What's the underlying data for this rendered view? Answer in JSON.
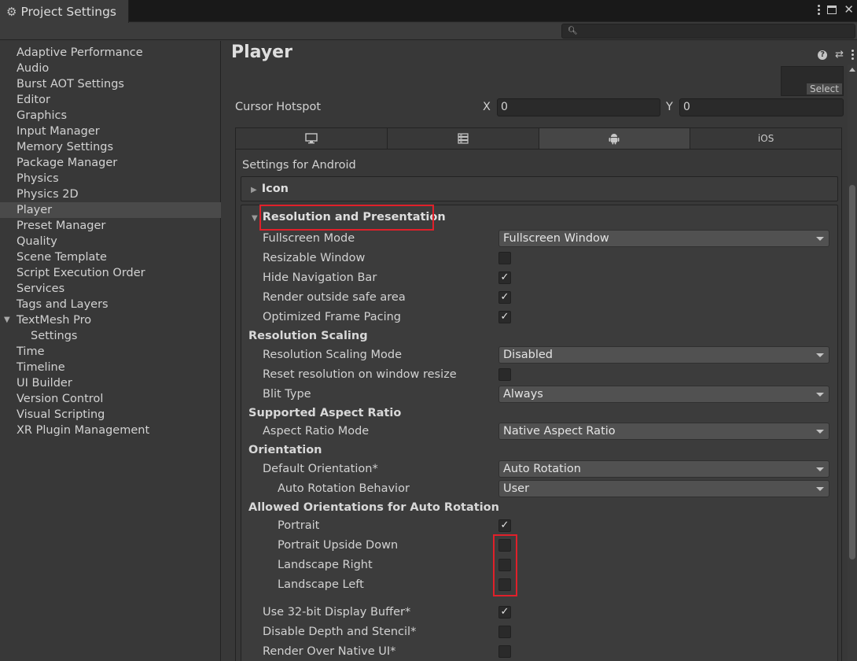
{
  "window": {
    "title": "Project Settings",
    "title_icon": "gear-icon"
  },
  "sidebar": {
    "items": [
      {
        "label": "Adaptive Performance"
      },
      {
        "label": "Audio"
      },
      {
        "label": "Burst AOT Settings"
      },
      {
        "label": "Editor"
      },
      {
        "label": "Graphics"
      },
      {
        "label": "Input Manager"
      },
      {
        "label": "Memory Settings"
      },
      {
        "label": "Package Manager"
      },
      {
        "label": "Physics"
      },
      {
        "label": "Physics 2D"
      },
      {
        "label": "Player",
        "selected": true
      },
      {
        "label": "Preset Manager"
      },
      {
        "label": "Quality"
      },
      {
        "label": "Scene Template"
      },
      {
        "label": "Script Execution Order"
      },
      {
        "label": "Services"
      },
      {
        "label": "Tags and Layers"
      },
      {
        "label": "TextMesh Pro",
        "expanded": true
      },
      {
        "label": "Settings",
        "child": true
      },
      {
        "label": "Time"
      },
      {
        "label": "Timeline"
      },
      {
        "label": "UI Builder"
      },
      {
        "label": "Version Control"
      },
      {
        "label": "Visual Scripting"
      },
      {
        "label": "XR Plugin Management"
      }
    ]
  },
  "main": {
    "title": "Player",
    "select_button": "Select",
    "cursor_hotspot": {
      "label": "Cursor Hotspot",
      "x_label": "X",
      "x_value": "0",
      "y_label": "Y",
      "y_value": "0"
    },
    "platform_tabs": [
      {
        "icon": "monitor-icon",
        "active": false
      },
      {
        "icon": "server-icon",
        "active": false
      },
      {
        "icon": "android-icon",
        "active": true
      },
      {
        "label": "iOS",
        "active": false
      }
    ],
    "settings_for": "Settings for Android",
    "icon_section": "Icon",
    "resolution_section": "Resolution and Presentation",
    "fullscreen_mode": {
      "label": "Fullscreen Mode",
      "value": "Fullscreen Window"
    },
    "resizable_window": {
      "label": "Resizable Window",
      "checked": false
    },
    "hide_nav_bar": {
      "label": "Hide Navigation Bar",
      "checked": true
    },
    "render_outside_safe": {
      "label": "Render outside safe area",
      "checked": true
    },
    "optimized_frame_pacing": {
      "label": "Optimized Frame Pacing",
      "checked": true
    },
    "resolution_scaling_header": "Resolution Scaling",
    "resolution_scaling_mode": {
      "label": "Resolution Scaling Mode",
      "value": "Disabled"
    },
    "reset_resolution": {
      "label": "Reset resolution on window resize",
      "checked": false
    },
    "blit_type": {
      "label": "Blit Type",
      "value": "Always"
    },
    "aspect_header": "Supported Aspect Ratio",
    "aspect_ratio_mode": {
      "label": "Aspect Ratio Mode",
      "value": "Native Aspect Ratio"
    },
    "orientation_header": "Orientation",
    "default_orientation": {
      "label": "Default Orientation*",
      "value": "Auto Rotation"
    },
    "auto_rotation_behavior": {
      "label": "Auto Rotation Behavior",
      "value": "User"
    },
    "allowed_orientations_header": "Allowed Orientations for Auto Rotation",
    "portrait": {
      "label": "Portrait",
      "checked": true
    },
    "portrait_upside_down": {
      "label": "Portrait Upside Down",
      "checked": false
    },
    "landscape_right": {
      "label": "Landscape Right",
      "checked": false
    },
    "landscape_left": {
      "label": "Landscape Left",
      "checked": false
    },
    "use_32bit_buffer": {
      "label": "Use 32-bit Display Buffer*",
      "checked": true
    },
    "disable_depth_stencil": {
      "label": "Disable Depth and Stencil*",
      "checked": false
    },
    "render_over_native_ui": {
      "label": "Render Over Native UI*",
      "checked": false
    }
  },
  "colors": {
    "highlight": "#e0202a",
    "background": "#383838"
  }
}
